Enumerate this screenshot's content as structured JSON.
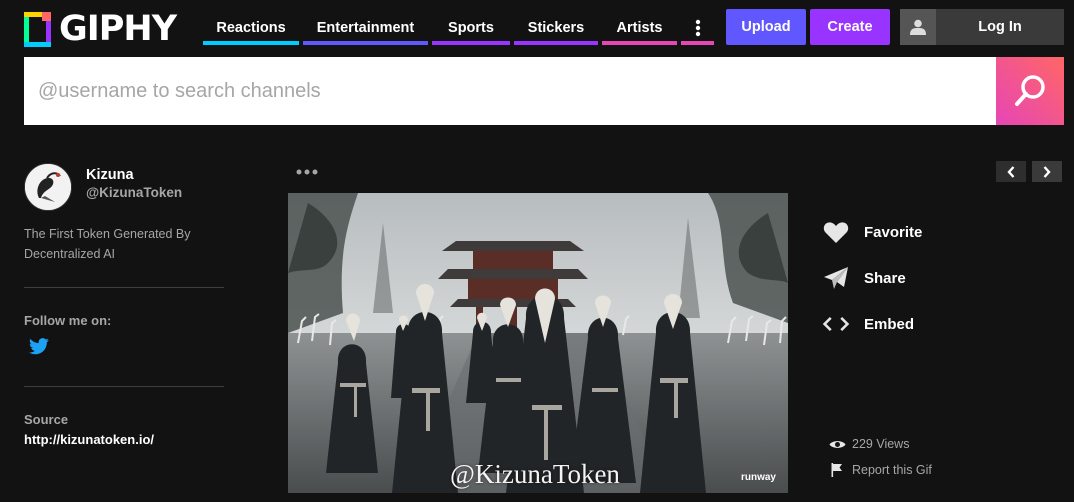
{
  "header": {
    "logo_text": "GIPHY",
    "nav": [
      {
        "label": "Reactions",
        "color": "#00ccff"
      },
      {
        "label": "Entertainment",
        "color": "#6157ff"
      },
      {
        "label": "Sports",
        "color": "#9933ff"
      },
      {
        "label": "Stickers",
        "color": "#9933ff"
      },
      {
        "label": "Artists",
        "color": "#e646b6"
      }
    ],
    "more_icon": "vertical-ellipsis-icon",
    "more_color": "#e646b6",
    "upload_label": "Upload",
    "upload_color": "#6157ff",
    "create_label": "Create",
    "create_color": "#9933ff",
    "login_label": "Log In",
    "login_icon": "user-icon"
  },
  "search": {
    "placeholder": "@username to search channels",
    "value": "",
    "icon": "search-icon"
  },
  "channel": {
    "name": "Kizuna",
    "handle": "@KizunaToken",
    "description": "The First Token Generated By Decentralized AI",
    "follow_label": "Follow me on:",
    "social_icon": "twitter-icon",
    "source_label": "Source",
    "source_url": "http://kizunatoken.io/"
  },
  "gif": {
    "more_icon": "horizontal-ellipsis-icon",
    "watermark": "@KizunaToken",
    "brand_mark": "runway"
  },
  "actions": {
    "favorite_label": "Favorite",
    "share_label": "Share",
    "embed_label": "Embed",
    "views": "229 Views",
    "report_label": "Report this Gif",
    "prev_icon": "chevron-left-icon",
    "next_icon": "chevron-right-icon"
  }
}
